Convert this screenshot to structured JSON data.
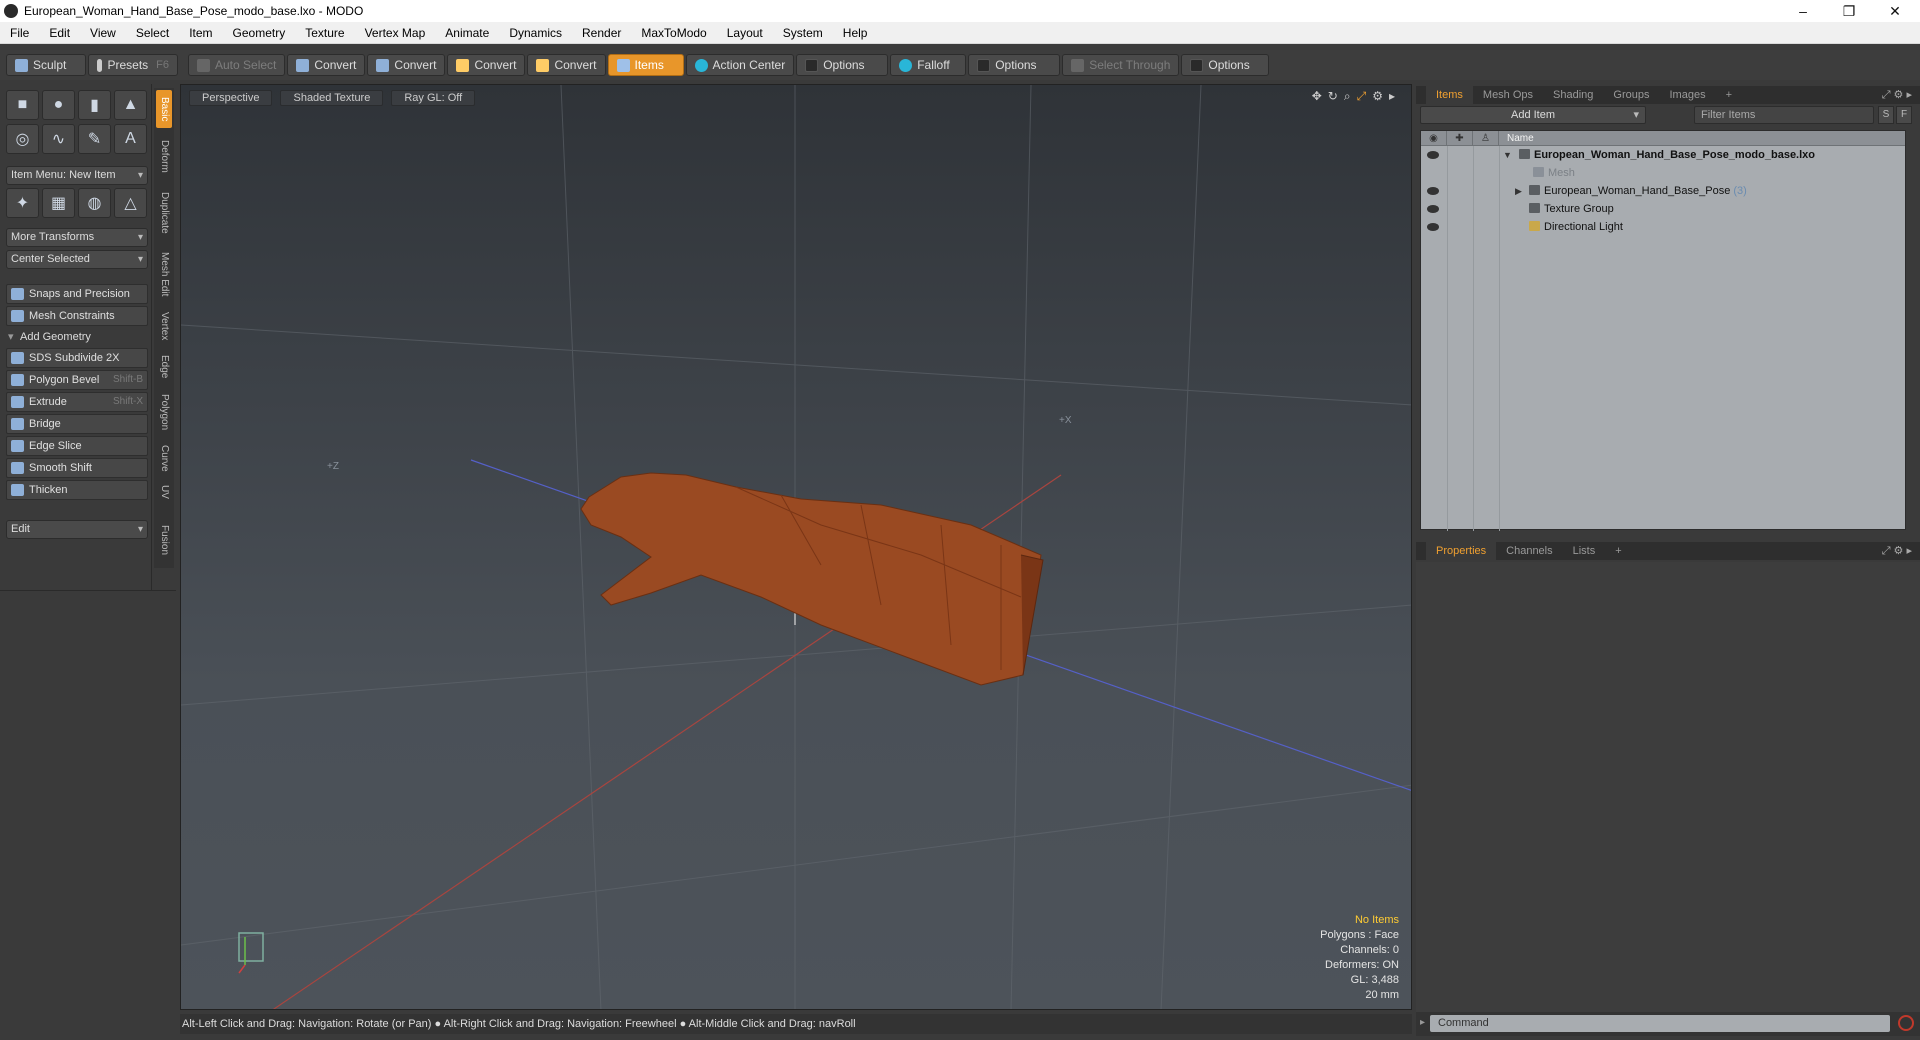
{
  "window": {
    "title": "European_Woman_Hand_Base_Pose_modo_base.lxo - MODO",
    "controls": [
      "–",
      "❐",
      "✕"
    ]
  },
  "menu": [
    "File",
    "Edit",
    "View",
    "Select",
    "Item",
    "Geometry",
    "Texture",
    "Vertex Map",
    "Animate",
    "Dynamics",
    "Render",
    "MaxToModo",
    "Layout",
    "System",
    "Help"
  ],
  "toolbar": {
    "sculpt": "Sculpt",
    "presets": "Presets",
    "presets_hotkey": "F6",
    "auto_select": "Auto Select",
    "convert1": "Convert",
    "convert2": "Convert",
    "convert3": "Convert",
    "convert4": "Convert",
    "items": "Items",
    "action_center": "Action Center",
    "options1": "Options",
    "falloff": "Falloff",
    "options2": "Options",
    "select_through": "Select Through",
    "options3": "Options"
  },
  "left": {
    "item_menu": "Item Menu: New Item",
    "more_transforms": "More Transforms",
    "center_selected": "Center Selected",
    "snaps": "Snaps and Precision",
    "constraints": "Mesh Constraints",
    "add_geometry": "Add Geometry",
    "tools": [
      {
        "label": "SDS Subdivide 2X",
        "hotkey": ""
      },
      {
        "label": "Polygon Bevel",
        "hotkey": "Shift-B"
      },
      {
        "label": "Extrude",
        "hotkey": "Shift-X"
      },
      {
        "label": "Bridge",
        "hotkey": ""
      },
      {
        "label": "Edge Slice",
        "hotkey": ""
      },
      {
        "label": "Smooth Shift",
        "hotkey": ""
      },
      {
        "label": "Thicken",
        "hotkey": ""
      }
    ],
    "edit": "Edit",
    "vtabs": [
      "Basic",
      "Deform",
      "Duplicate",
      "Mesh Edit",
      "Vertex",
      "Edge",
      "Polygon",
      "Curve",
      "UV",
      "Fusion"
    ]
  },
  "viewport": {
    "view": "Perspective",
    "shading": "Shaded Texture",
    "raygl": "Ray GL: Off",
    "axis_x": "+X",
    "axis_z": "+Z",
    "info": {
      "no_items": "No Items",
      "polygons": "Polygons : Face",
      "channels": "Channels: 0",
      "deformers": "Deformers: ON",
      "gl": "GL: 3,488",
      "scale": "20 mm"
    }
  },
  "status": "Alt-Left Click and Drag: Navigation: Rotate (or Pan) ● Alt-Right Click and Drag: Navigation: Freewheel ● Alt-Middle Click and Drag: navRoll",
  "items_panel": {
    "tabs": [
      "Items",
      "Mesh Ops",
      "Shading",
      "Groups",
      "Images",
      "+"
    ],
    "add_item": "Add Item",
    "filter_placeholder": "Filter Items",
    "s_btn": "S",
    "f_btn": "F",
    "name_col": "Name",
    "tree": {
      "root": "European_Woman_Hand_Base_Pose_modo_base.lxo",
      "mesh": "Mesh",
      "group": "European_Woman_Hand_Base_Pose",
      "group_count": "(3)",
      "texture_group": "Texture Group",
      "light": "Directional Light"
    }
  },
  "props_panel": {
    "tabs": [
      "Properties",
      "Channels",
      "Lists",
      "+"
    ]
  },
  "command": {
    "placeholder": "Command"
  }
}
